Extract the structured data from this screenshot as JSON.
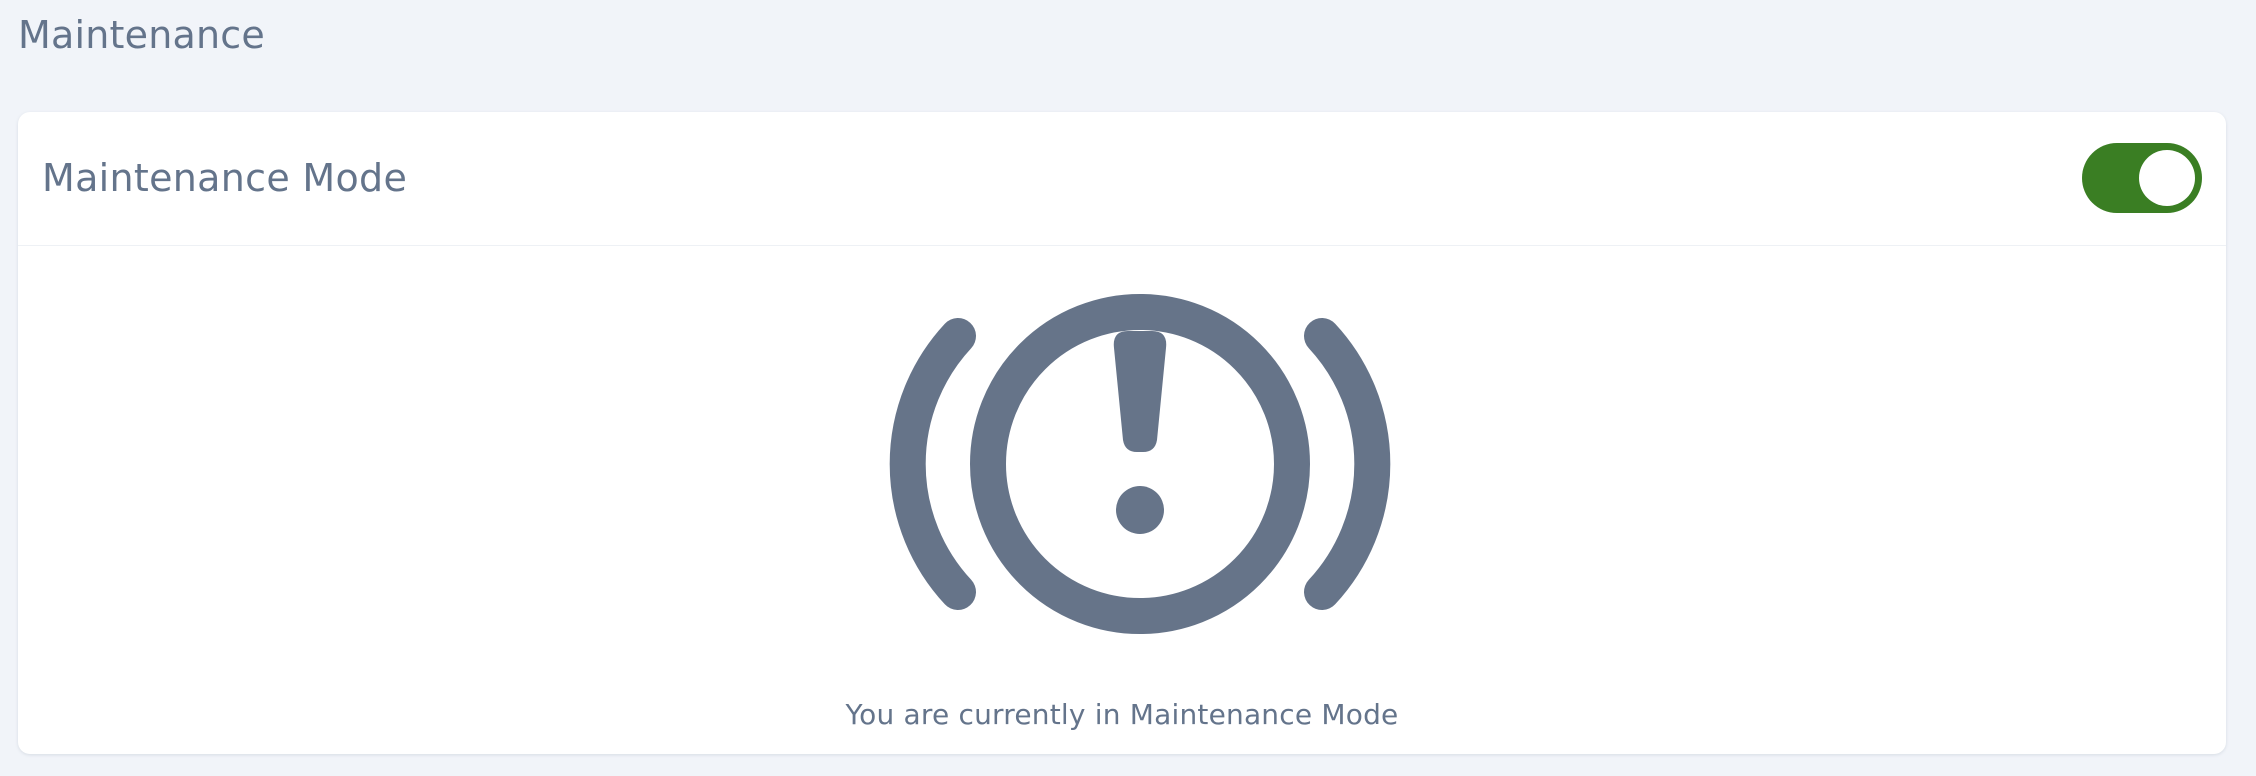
{
  "page": {
    "title": "Maintenance"
  },
  "card": {
    "title": "Maintenance Mode",
    "toggle": {
      "state": "on",
      "color": "#3a7e23"
    },
    "icon": "maintenance-alert-icon",
    "message": "You are currently in Maintenance Mode"
  },
  "colors": {
    "background": "#f1f4f9",
    "text": "#64748b",
    "icon": "#667489",
    "toggle_on": "#3a7e23"
  }
}
